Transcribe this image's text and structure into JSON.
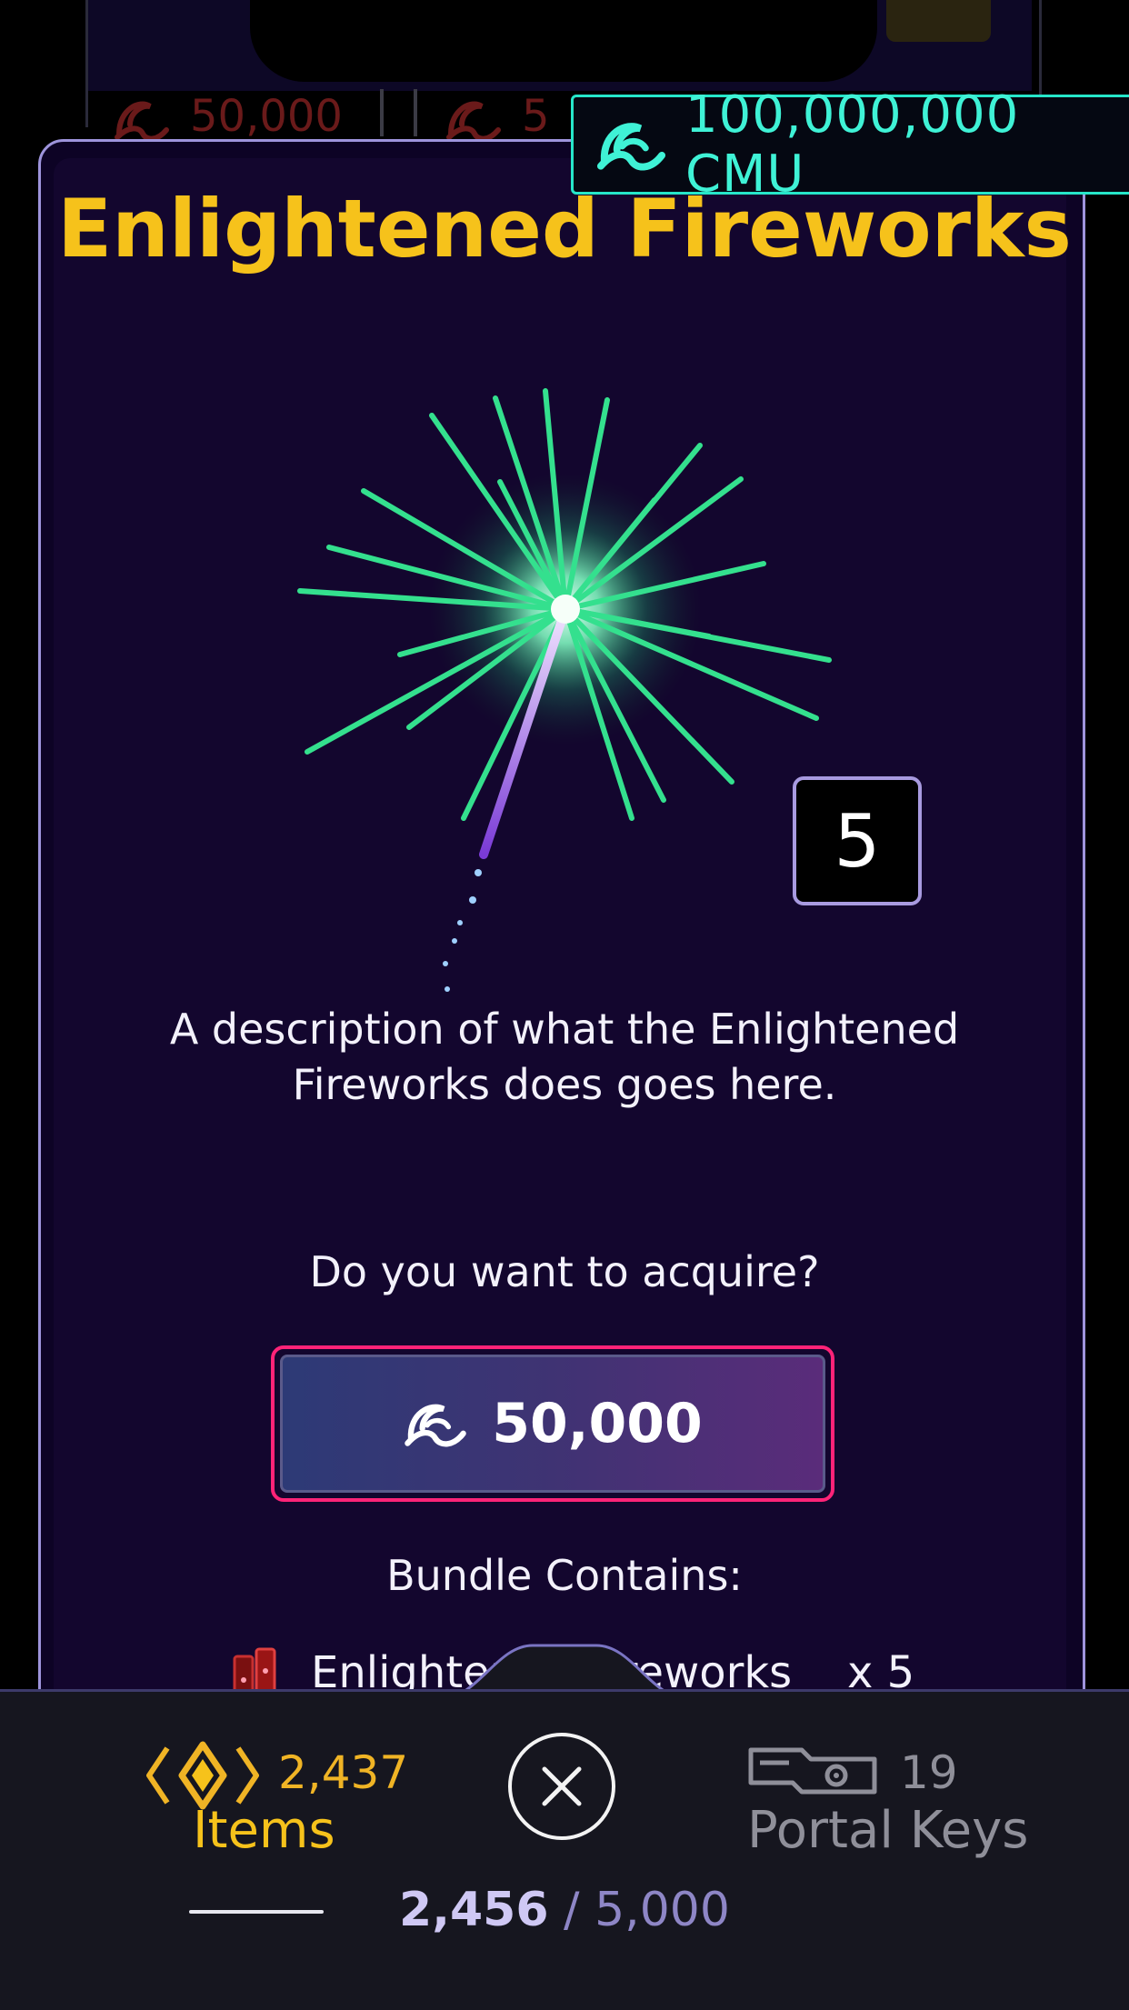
{
  "background": {
    "price_left": "50,000",
    "price_right": "5"
  },
  "wallet": {
    "balance": "100,000,000 CMU",
    "icon": "cmu-coin-icon",
    "color": "#3ff2d6"
  },
  "modal": {
    "title": "Enlightened Fireworks",
    "quantity": "5",
    "description": "A description of what the Enlightened Fireworks does goes here.",
    "prompt": "Do you want to acquire?",
    "buy_button": {
      "icon": "cmu-coin-icon",
      "price": "50,000"
    },
    "bundle_title": "Bundle Contains:",
    "bundle_items": [
      {
        "icon": "firework-item-icon",
        "name": "Enlightened Fireworks",
        "quantity": "x 5"
      }
    ]
  },
  "inventory_bar": {
    "items_tab": {
      "icon": "items-icon",
      "count": "2,437",
      "label": "Items",
      "selected": true
    },
    "close_icon": "close-icon",
    "keys_tab": {
      "icon": "portal-key-icon",
      "count": "19",
      "label": "Portal Keys"
    },
    "capacity_used": "2,456",
    "capacity_separator": "/",
    "capacity_total": "5,000"
  },
  "colors": {
    "title": "#f6c21b",
    "accent_teal": "#26e6c9",
    "button_border": "#ff2378",
    "modal_border": "#9e94dc"
  }
}
